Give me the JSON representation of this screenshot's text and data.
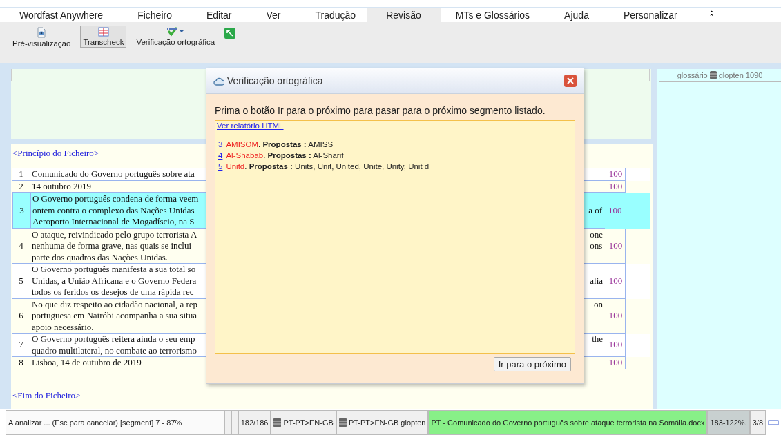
{
  "menu": [
    {
      "label": "Wordfast Anywhere",
      "selected": false
    },
    {
      "label": "Ficheiro",
      "selected": false
    },
    {
      "label": "Editar",
      "selected": false
    },
    {
      "label": "Ver",
      "selected": false
    },
    {
      "label": "Tradução",
      "selected": false
    },
    {
      "label": "Revisão",
      "selected": true
    },
    {
      "label": "MTs e Glossários",
      "selected": false
    },
    {
      "label": "Ajuda",
      "selected": false
    },
    {
      "label": "Personalizar",
      "selected": false
    }
  ],
  "collapse_glyph": "⌃",
  "toolbar": [
    {
      "kind": "preview",
      "label": "Pré-visualização",
      "pressed": false
    },
    {
      "kind": "table",
      "label": "Transcheck",
      "pressed": true
    },
    {
      "kind": "spell",
      "label": "Verificação ortográfica",
      "pressed": false
    },
    {
      "kind": "green"
    }
  ],
  "document": {
    "start": "<Princípio do Ficheiro>",
    "end": "<Fim do Ficheiro>",
    "segments": [
      {
        "number": "1",
        "source": [
          "Comunicado do Governo português sobre ata"
        ],
        "score": "100",
        "selected": false
      },
      {
        "number": "2",
        "source": [
          "14 outubro 2019"
        ],
        "score": "100",
        "selected": false
      },
      {
        "number": "3",
        "source": [
          "O Governo português condena de forma veem",
          "ontem contra o complexo das Nações Unidas",
          "Aeroporto Internacional de Mogadíscio, na S"
        ],
        "target": [
          "a of"
        ],
        "kind": "centered",
        "score": "100",
        "selected": true
      },
      {
        "number": "4",
        "source": [
          "O ataque, reivindicado pelo grupo terrorista A",
          "nenhuma de forma grave, nas quais se inclui",
          "parte dos quadros das Nações Unidas."
        ],
        "target": [
          "one",
          "ons"
        ],
        "kind": "top",
        "score": "100",
        "selected": false
      },
      {
        "number": "5",
        "source": [
          "O Governo português manifesta a sua total so",
          "Unidas, a União Africana e o Governo Federa",
          "todos os feridos os desejos de uma rápida rec"
        ],
        "target": [
          "alia"
        ],
        "kind": "centered",
        "score": "100",
        "selected": false
      },
      {
        "number": "6",
        "source": [
          "No que diz respeito ao cidadão nacional, a rep",
          "portuguesa em Nairóbi acompanha a sua situa",
          "apoio necessário."
        ],
        "target": [
          "on"
        ],
        "kind": "top",
        "score": "100",
        "selected": false
      },
      {
        "number": "7",
        "source": [
          "O Governo português reitera ainda o seu emp",
          "quadro multilateral, no combate ao terrorismo"
        ],
        "target": [
          "the"
        ],
        "kind": "top",
        "score": "100",
        "selected": false
      },
      {
        "number": "8",
        "source": [
          "Lisboa, 14 de outubro de 2019"
        ],
        "score": "100",
        "selected": false
      }
    ]
  },
  "glossary_panel": {
    "label": "glossário",
    "name": "glopten 1090"
  },
  "dialog": {
    "title": "Verificação ortográfica",
    "instruction": "Prima o botão Ir para o próximo para pasar para o próximo segmento listado.",
    "report_link": "Ver relatório HTML",
    "items": [
      {
        "segment": "3",
        "word": "AMISOM",
        "separator": ".",
        "label": "Propostas :",
        "suggestions": "AMISS"
      },
      {
        "segment": "4",
        "word": "Al-Shabab",
        "separator": ".",
        "label": "Propostas :",
        "suggestions": "Al-Sharif"
      },
      {
        "segment": "5",
        "word": "Unitd",
        "separator": ".",
        "label": "Propostas :",
        "suggestions": "Units, Unit, United, Unite, Unity, Unit d"
      }
    ],
    "button": "Ir para o próximo"
  },
  "status_bar": [
    {
      "kind": "text",
      "text": "A analizar ... (Esc para cancelar) [segment] 7 - 87%"
    },
    {
      "kind": "empty"
    },
    {
      "kind": "empty"
    },
    {
      "kind": "text",
      "text": "182/186"
    },
    {
      "kind": "db",
      "text": "PT-PT>EN-GB"
    },
    {
      "kind": "db",
      "text": "PT-PT>EN-GB glopten"
    },
    {
      "kind": "file",
      "text": "PT - Comunicado do Governo português sobre ataque terrorista na Somália.docx"
    },
    {
      "kind": "grey",
      "text": "183-122%."
    },
    {
      "kind": "text",
      "text": "3/8"
    },
    {
      "kind": "icon"
    }
  ]
}
